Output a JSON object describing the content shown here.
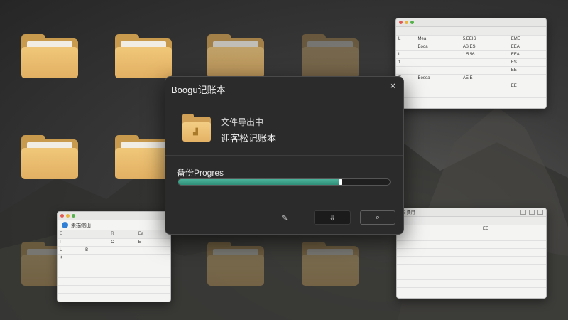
{
  "dialog": {
    "title": "Boogu记账本",
    "close_glyph": "×",
    "line1": "文件导出中",
    "line2": "迎客松记账本",
    "progress_label": "备份Progres",
    "progress_fraction": 0.77,
    "buttons": [
      {
        "glyph": "✎"
      },
      {
        "glyph": "⇩"
      },
      {
        "glyph": "⌕"
      }
    ]
  },
  "window_top_right": {
    "title": "",
    "header": [
      "",
      "",
      "",
      ""
    ],
    "rows": [
      [
        "L",
        "Mea",
        "5.EEIS",
        "EME"
      ],
      [
        "",
        "Eooa",
        "AS.ES",
        "EEA"
      ],
      [
        "L",
        "",
        "1.5 56",
        "EEA"
      ],
      [
        "1",
        "",
        "",
        "ES"
      ],
      [
        "",
        "",
        "",
        "EE"
      ],
      [
        "E",
        "Bosea",
        "AE.E",
        ""
      ],
      [
        "",
        "",
        "",
        "EE"
      ],
      [
        "",
        "",
        "",
        ""
      ]
    ]
  },
  "window_bottom_left": {
    "title": "素描缩山",
    "header": [
      "E",
      "R",
      "Ea"
    ],
    "rows": [
      [
        "I",
        "",
        "O",
        "E"
      ],
      [
        "L",
        "B",
        "",
        ""
      ],
      [
        "K",
        "",
        "",
        ""
      ],
      [
        "",
        "",
        "",
        ""
      ],
      [
        "",
        "",
        "",
        ""
      ],
      [
        "",
        "",
        "",
        ""
      ],
      [
        "",
        "",
        "",
        ""
      ]
    ]
  },
  "window_bottom_right": {
    "title": "E 费用",
    "header": [
      "",
      "",
      "",
      ""
    ],
    "rows": [
      [
        "",
        "",
        "",
        "EE"
      ],
      [
        "",
        "",
        "",
        ""
      ],
      [
        "",
        "",
        "",
        ""
      ],
      [
        "",
        "",
        "",
        ""
      ],
      [
        "",
        "",
        "",
        ""
      ],
      [
        "",
        "",
        "",
        ""
      ],
      [
        "",
        "",
        "",
        ""
      ],
      [
        "",
        "",
        "",
        ""
      ]
    ]
  },
  "colors": {
    "accent_progress": "#3aa088",
    "dialog_bg": "#2b2b2b",
    "folder_front": "#f0c77a"
  }
}
